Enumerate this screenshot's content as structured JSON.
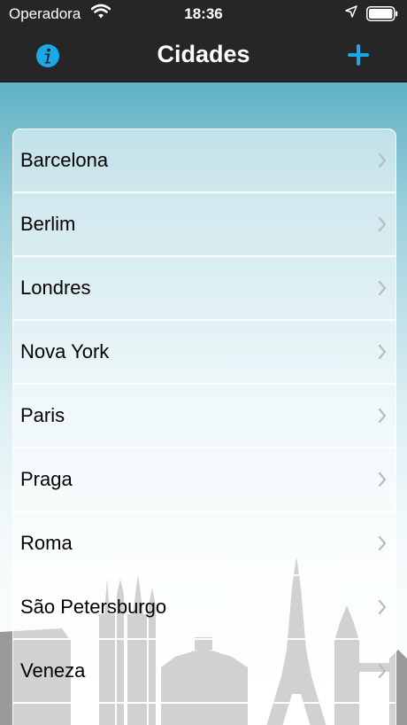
{
  "status_bar": {
    "carrier": "Operadora",
    "time": "18:36"
  },
  "nav": {
    "title": "Cidades",
    "info_icon": "info-icon",
    "add_icon": "plus-icon",
    "accent_color": "#1aa9e8"
  },
  "cities": [
    "Barcelona",
    "Berlim",
    "Londres",
    "Nova York",
    "Paris",
    "Praga",
    "Roma",
    "São Petersburgo",
    "Veneza"
  ],
  "colors": {
    "bar_background": "#262626",
    "sky_top": "#5fb1c4",
    "skyline": "#9a9a9a"
  }
}
